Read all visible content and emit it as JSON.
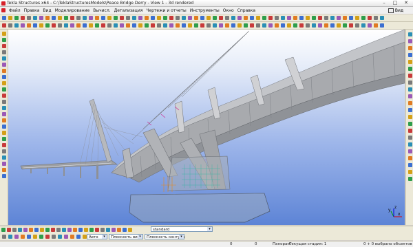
{
  "window": {
    "title": "Tekla Structures x64 - C:\\TeklaStructuresModels\\Peace Bridge Derry - View 1 - 3d rendered"
  },
  "menu": [
    "Файл",
    "Правка",
    "Вид",
    "Моделирование",
    "Вычисл.",
    "Детализация",
    "Чертежи и отчеты",
    "Инструменты",
    "Окно",
    "Справка"
  ],
  "view_tab": {
    "label": "Вид"
  },
  "bottom_toolbar": {
    "view_option": "standard"
  },
  "selectors": {
    "mode": "Авто",
    "plane1": "Плоскость вида",
    "plane2": "Плоскость контура"
  },
  "status": {
    "v1": "0",
    "v2": "0",
    "mode": "Панорам.",
    "phase": "Текущая стадия: 1",
    "selection": "0 + 0 выбрано объектов"
  },
  "axes": {
    "x": "x",
    "y": "y",
    "z": "z"
  },
  "icon_names": [
    "new-icon",
    "open-icon",
    "save-icon",
    "undo-icon",
    "redo-icon",
    "copy-icon",
    "move-icon",
    "delete-icon",
    "zoom-icon",
    "rotate-icon",
    "pan-icon",
    "render-icon",
    "snap-icon",
    "select-icon",
    "measure-icon",
    "grid-icon",
    "beam-icon",
    "column-icon",
    "plate-icon",
    "bolt-icon",
    "weld-icon",
    "properties-icon"
  ]
}
